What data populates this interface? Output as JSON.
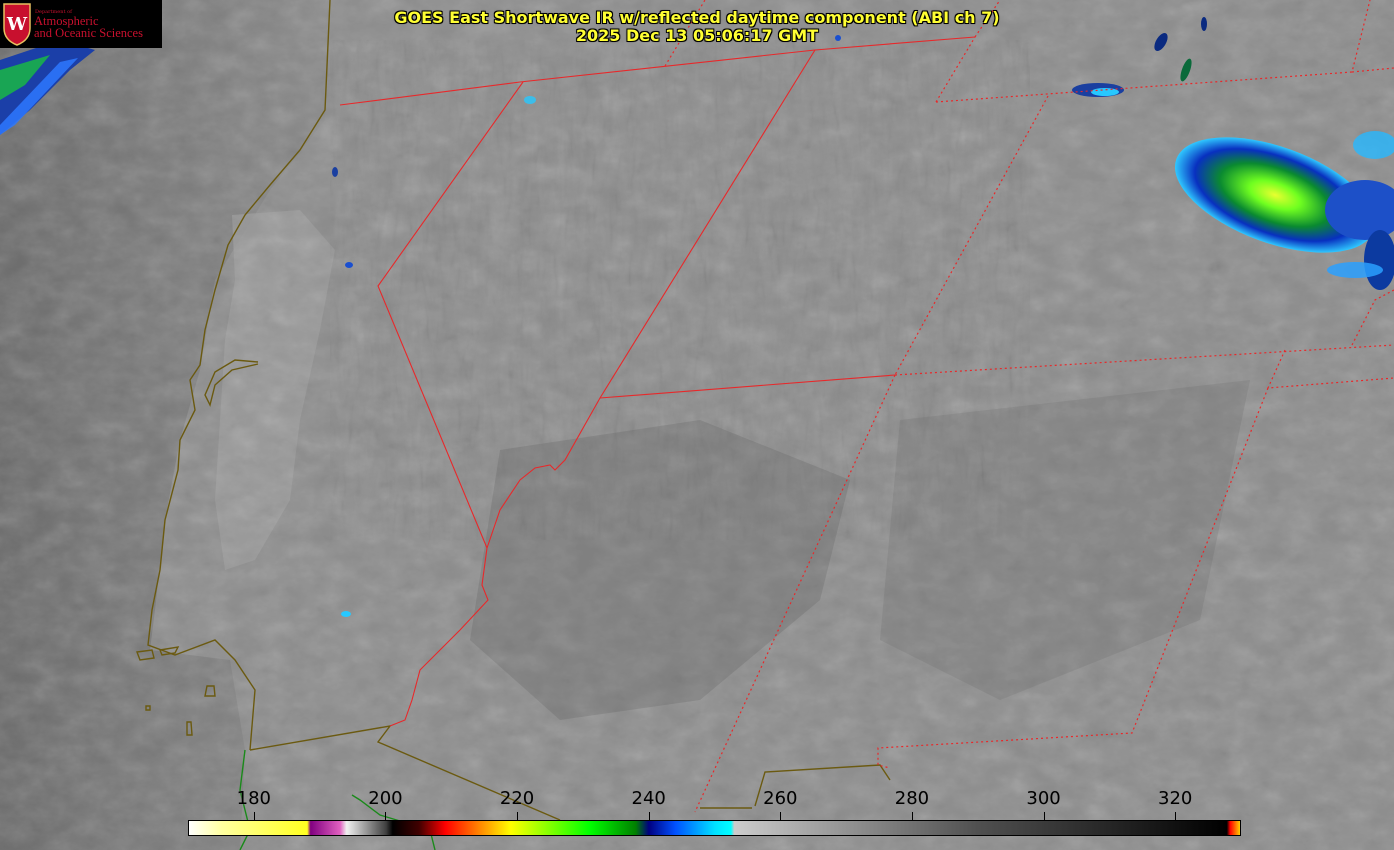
{
  "title": {
    "line1": "GOES East Shortwave IR w/reflected daytime component (ABI ch 7)",
    "line2": "2025 Dec 13 05:06:17 GMT",
    "color": "#ffff33"
  },
  "logo": {
    "dept_line": "Department of",
    "line1": "Atmospheric",
    "line2": "and Oceanic Sciences",
    "crest_letter": "W",
    "color": "#c8102e",
    "icon": "uw-crest-icon"
  },
  "map": {
    "border_colors": {
      "state": "#e8282a",
      "country_coast": "#6b5a10",
      "water_coast": "#1a8a1a"
    }
  },
  "colorbar": {
    "min": 170,
    "max": 330,
    "ticks": [
      "180",
      "200",
      "220",
      "240",
      "260",
      "280",
      "300",
      "320"
    ],
    "tick_values": [
      180,
      200,
      220,
      240,
      260,
      280,
      300,
      320
    ],
    "stops": [
      {
        "value": 170,
        "color": "#ffffff"
      },
      {
        "value": 175,
        "color": "#ffffa0"
      },
      {
        "value": 188,
        "color": "#ffff20"
      },
      {
        "value": 188.5,
        "color": "#800080"
      },
      {
        "value": 193,
        "color": "#e060c0"
      },
      {
        "value": 194,
        "color": "#f0f0f0"
      },
      {
        "value": 200,
        "color": "#404040"
      },
      {
        "value": 201,
        "color": "#000000"
      },
      {
        "value": 205,
        "color": "#400000"
      },
      {
        "value": 209,
        "color": "#ff0000"
      },
      {
        "value": 214,
        "color": "#ff8000"
      },
      {
        "value": 219,
        "color": "#ffff00"
      },
      {
        "value": 225,
        "color": "#80ff00"
      },
      {
        "value": 231,
        "color": "#00ff00"
      },
      {
        "value": 238,
        "color": "#008000"
      },
      {
        "value": 240,
        "color": "#000080"
      },
      {
        "value": 244,
        "color": "#0050ff"
      },
      {
        "value": 250,
        "color": "#00e0ff"
      },
      {
        "value": 252.5,
        "color": "#00ffff"
      },
      {
        "value": 253,
        "color": "#cccccc"
      },
      {
        "value": 290,
        "color": "#505050"
      },
      {
        "value": 328,
        "color": "#000000"
      },
      {
        "value": 328.5,
        "color": "#ff0000"
      },
      {
        "value": 330,
        "color": "#ffd000"
      }
    ]
  }
}
